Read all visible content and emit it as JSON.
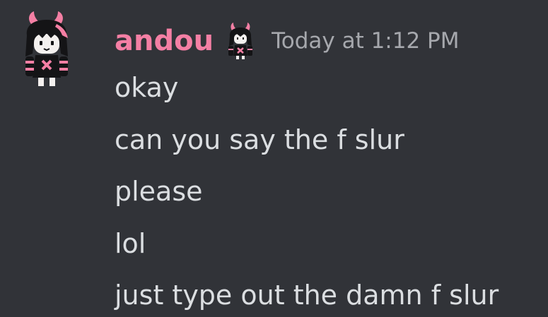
{
  "message": {
    "author": {
      "name": "andou",
      "name_color": "#f47fa4",
      "avatar_icon": "pink-horned-girl-avatar",
      "role_icon": "pink-horned-girl-badge"
    },
    "timestamp": "Today at 1:12 PM",
    "lines": [
      "okay",
      "can you say the f slur",
      "please",
      "lol",
      "just type out the damn f slur"
    ]
  },
  "colors": {
    "background": "#313338",
    "text": "#dbdee1",
    "timestamp": "#a6a8ad",
    "accent_pink": "#f47fa4"
  }
}
